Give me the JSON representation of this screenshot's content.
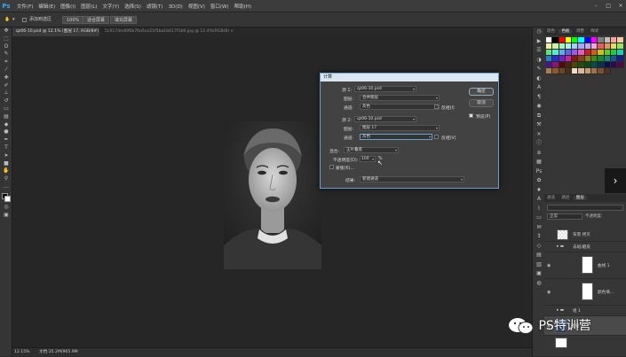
{
  "app": {
    "logo": "Ps"
  },
  "menubar": {
    "items": [
      "文件(F)",
      "编辑(E)",
      "图像(I)",
      "图层(L)",
      "文字(Y)",
      "选择(S)",
      "滤镜(T)",
      "3D(D)",
      "视图(V)",
      "窗口(W)",
      "帮助(H)"
    ],
    "controls": [
      "–",
      "□",
      "×"
    ]
  },
  "options_bar": {
    "sample_all_label": "添加到选区",
    "zoom": "100%",
    "fit_button": "适合屏幕",
    "fill_button": "填充屏幕"
  },
  "tabs": [
    {
      "label": "qz06-10.psd @ 12.1% (图层 17, RGB/8#) *  ×"
    },
    {
      "label": "5c0174ed0f6b76a5ce21f5ba1b617f1b9.jpg @ 12.4%(RGB/8) ×"
    }
  ],
  "status": {
    "zoom": "12.15%",
    "doc": "文档:35.2M/965.9M"
  },
  "dialog": {
    "title": "计算",
    "source1_label": "源 1:",
    "source1_file": "qz06-10.psd",
    "layer1_label": "图层:",
    "layer1_value": "合并图层",
    "channel1_label": "通道:",
    "channel1_value": "灰色",
    "invert1_label": "反相(I)",
    "source2_label": "源 2:",
    "source2_file": "qz06-10.psd",
    "layer2_label": "图层:",
    "layer2_value": "图层 17",
    "channel2_label": "通道:",
    "channel2_value": "灰色",
    "invert2_label": "反相(V)",
    "blending_label": "混合:",
    "blending_value": "正片叠底",
    "opacity_label": "不透明度(O):",
    "opacity_value": "100",
    "opacity_unit": "%",
    "mask_label": "蒙版(K)...",
    "result_label": "结果:",
    "result_value": "新建通道",
    "ok_button": "确定",
    "cancel_button": "取消",
    "preview_label": "预览(P)"
  },
  "right_panel": {
    "top_tabs": [
      "颜色",
      "色板",
      "调整",
      "样式"
    ],
    "layer_tabs": [
      "通道",
      "路径",
      "图层"
    ],
    "layers_header": "正常",
    "opacity_label": "不透明度:",
    "layers": [
      {
        "name": "背景 拷贝",
        "visible": false,
        "thumb": "white"
      },
      {
        "name": "去斑/磨皮",
        "visible": false,
        "thumb": "folder"
      },
      {
        "name": "曲线 1",
        "visible": true,
        "thumb": "white"
      },
      {
        "name": "颜色填...",
        "visible": true,
        "thumb": "white"
      },
      {
        "name": "组 1",
        "visible": false,
        "thumb": "folder"
      },
      {
        "name": "图层 17",
        "visible": true,
        "thumb": "photo",
        "selected": true
      }
    ]
  },
  "watermark": {
    "text": "PS特训营",
    "icon": "wechat-icon"
  },
  "swatch_colors": [
    "#ffffff",
    "#000000",
    "#ff0000",
    "#ffff00",
    "#00ff00",
    "#00ffff",
    "#0000ff",
    "#ff00ff",
    "#808080",
    "#c0c0c0",
    "#f5a3a3",
    "#f5c9a3",
    "#f5eea3",
    "#c9f5a3",
    "#a3f5b5",
    "#a3f5e9",
    "#a3d1f5",
    "#a3a9f5",
    "#c4a3f5",
    "#f5a3e0",
    "#e65c5c",
    "#e6935c",
    "#e6d95c",
    "#93e65c",
    "#5ce67a",
    "#5ce6d2",
    "#5caee6",
    "#5c67e6",
    "#9b5ce6",
    "#e65cc7",
    "#cc1f1f",
    "#cc5f1f",
    "#ccbc1f",
    "#5fcc1f",
    "#1fcc44",
    "#1fccb3",
    "#1f82cc",
    "#1f2ecc",
    "#6f1fcc",
    "#cc1fa5",
    "#8a1414",
    "#8a4014",
    "#8a7f14",
    "#408a14",
    "#148a2e",
    "#148a79",
    "#14588a",
    "#141f8a",
    "#4b148a",
    "#8a1470",
    "#4d0b0b",
    "#4d240b",
    "#4d470b",
    "#244d0b",
    "#0b4d1a",
    "#0b4d43",
    "#0b314d",
    "#0b114d",
    "#2a0b4d",
    "#4d0b3e",
    "#a67c52",
    "#8b5a2b",
    "#6b4423",
    "#4a2f18",
    "#f0dcc8",
    "#d9b99b",
    "#c69c6d",
    "#a0704a",
    "#7a5030",
    "#503020"
  ]
}
